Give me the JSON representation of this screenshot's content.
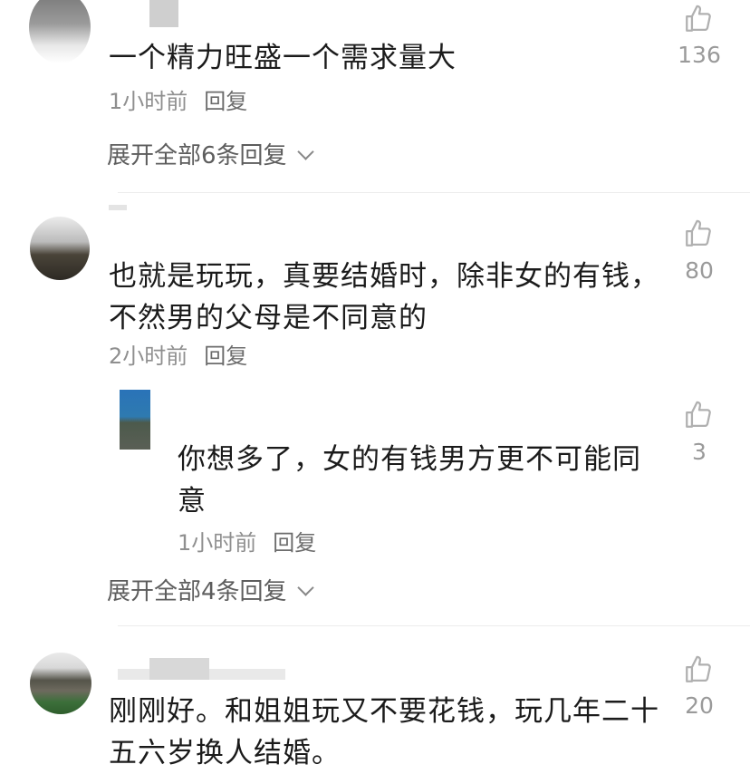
{
  "comments": [
    {
      "text": "一个精力旺盛一个需求量大",
      "time": "1小时前",
      "reply_label": "回复",
      "likes": "136",
      "expand_label": "展开全部6条回复"
    },
    {
      "text": "也就是玩玩，真要结婚时，除非女的有钱，不然男的父母是不同意的",
      "time": "2小时前",
      "reply_label": "回复",
      "likes": "80",
      "expand_label": "展开全部4条回复",
      "sub_reply": {
        "text": "你想多了，女的有钱男方更不可能同意",
        "time": "1小时前",
        "reply_label": "回复",
        "likes": "3"
      }
    },
    {
      "text": "刚刚好。和姐姐玩又不要花钱，玩几年二十五六岁换人结婚。",
      "likes": "20"
    }
  ],
  "icons": {
    "like": "thumbs-up-icon",
    "expand": "chevron-down-icon"
  },
  "colors": {
    "meta": "#8f8f8f",
    "reply": "#6c6c6c",
    "like_icon": "#b0b0b0"
  }
}
